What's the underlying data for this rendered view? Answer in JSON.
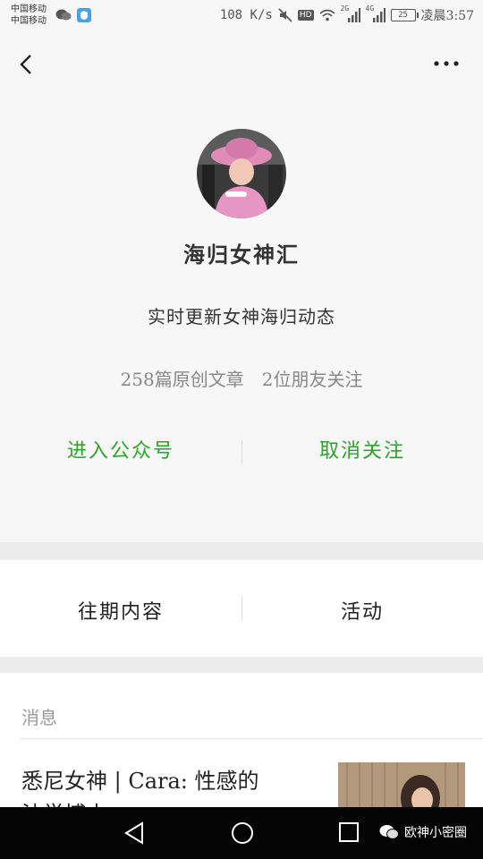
{
  "status_bar": {
    "carrier_1": "中国移动",
    "carrier_2": "中国移动",
    "speed": "108 K/s",
    "net_2g": "2G",
    "net_4g": "4G",
    "hd": "HD",
    "battery": "25",
    "time": "凌晨3:57"
  },
  "nav": {
    "back_icon": "chevron-left",
    "more_icon": "ellipsis"
  },
  "profile": {
    "name": "海归女神汇",
    "description": "实时更新女神海归动态",
    "articles": "258篇原创文章",
    "followers": "2位朋友关注",
    "enter_label": "进入公众号",
    "unfollow_label": "取消关注",
    "accent_color": "#2aa52a"
  },
  "tabs": [
    {
      "label": "往期内容"
    },
    {
      "label": "活动"
    }
  ],
  "messages": {
    "header": "消息",
    "items": [
      {
        "title": "悉尼女神 | Cara: 性感的",
        "subtitle": "法学博士..."
      }
    ]
  },
  "watermark": {
    "text": "欧神小密圈"
  }
}
